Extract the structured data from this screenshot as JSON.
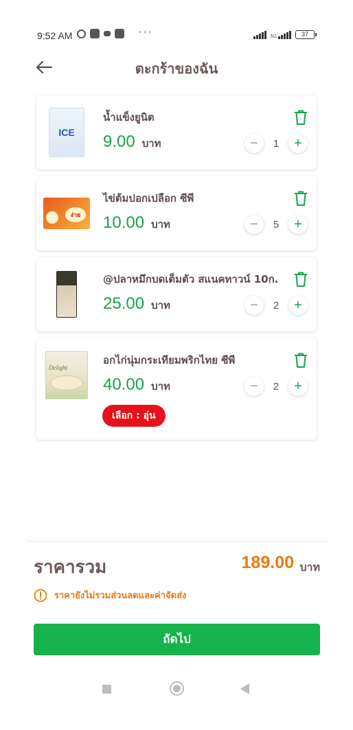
{
  "status_bar": {
    "time": "9:52 AM",
    "more": "···",
    "network": "5G",
    "battery": "37"
  },
  "header": {
    "title": "ตะกร้าของฉัน",
    "back_icon": "arrow-left-icon"
  },
  "cart": {
    "items": [
      {
        "name": "น้ำแข็งยูนิต",
        "price": "9.00",
        "unit": "บาท",
        "quantity": "1",
        "image_text": "ICE",
        "option": null
      },
      {
        "name": "ไข่ต้มปอกเปลือก ซีพี",
        "price": "10.00",
        "unit": "บาท",
        "quantity": "5",
        "image_text": "ง่าย",
        "option": null
      },
      {
        "name": "@ปลาหมึกบดเต็มตัว สแนคทาวน์ 10ก.",
        "price": "25.00",
        "unit": "บาท",
        "quantity": "2",
        "option": null
      },
      {
        "name": "อกไก่นุ่มกระเทียมพริกไทย ซีพี",
        "price": "40.00",
        "unit": "บาท",
        "quantity": "2",
        "image_text": "Delight",
        "option": "เลือก : อุ่น"
      }
    ],
    "minus_symbol": "−",
    "plus_symbol": "+"
  },
  "summary": {
    "total_label": "ราคารวม",
    "total_value": "189.00",
    "total_unit": "บาท",
    "notice": "ราคายังไม่รวมส่วนลดและค่าจัดส่ง",
    "next_button": "ถัดไป"
  },
  "colors": {
    "green": "#16b24b",
    "orange": "#ea7a10",
    "red": "#e8111b"
  }
}
